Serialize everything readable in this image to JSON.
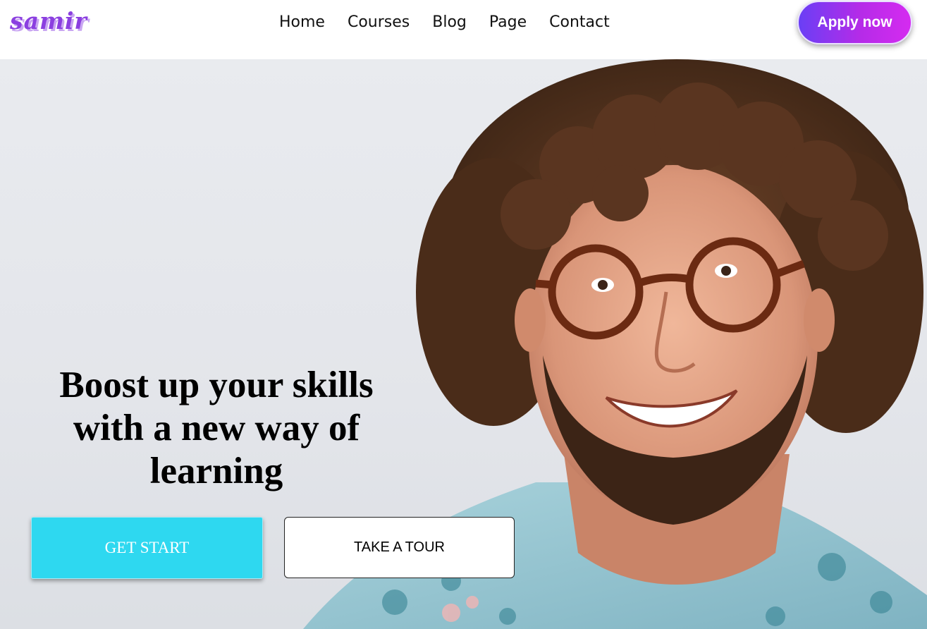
{
  "header": {
    "logo": "samir",
    "nav": [
      "Home",
      "Courses",
      "Blog",
      "Page",
      "Contact"
    ],
    "apply_label": "Apply now"
  },
  "hero": {
    "title": "Boost up your skills with a new way of learning",
    "primary_button": "GET START",
    "secondary_button": "TAKE A TOUR",
    "photo_subject": "smiling curly-haired man with tortoiseshell glasses and beard"
  },
  "colors": {
    "logo": "#8b3fe0",
    "apply_gradient_start": "#6a3ff5",
    "apply_gradient_end": "#d52bf0",
    "primary_button": "#2ed8f0",
    "hero_background": "#e6e8ec"
  }
}
